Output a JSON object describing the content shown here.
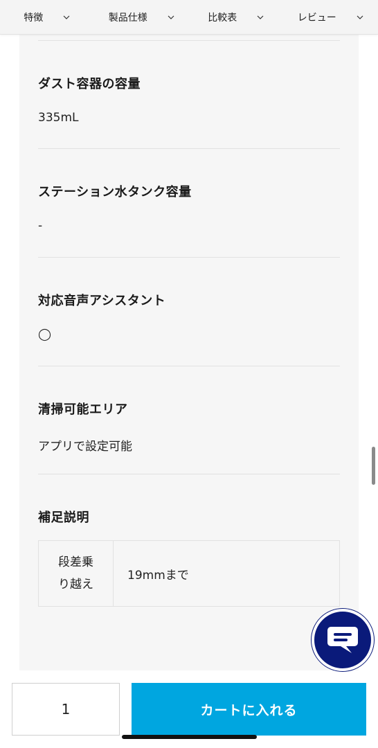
{
  "nav": {
    "tabs": [
      {
        "label": "特徴"
      },
      {
        "label": "製品仕様"
      },
      {
        "label": "比較表"
      },
      {
        "label": "レビュー"
      }
    ]
  },
  "specs": [
    {
      "label": "ダスト容器の容量",
      "value": "335mL"
    },
    {
      "label": "ステーション水タンク容量",
      "value": "-"
    },
    {
      "label": "対応音声アシスタント",
      "value": "◯"
    },
    {
      "label": "清掃可能エリア",
      "value": "アプリで設定可能"
    }
  ],
  "supplement": {
    "label": "補足説明",
    "table": {
      "header_line1": "段差乗",
      "header_line2": "り越え",
      "value": "19mmまで"
    }
  },
  "cart_bar": {
    "quantity": "1",
    "add_to_cart_label": "カートに入れる"
  },
  "colors": {
    "cart_button": "#00a6e0",
    "chat_button": "#0a1a7a",
    "panel_background": "#f6f6f6"
  },
  "icons": {
    "tab_chevron": "chevron-down-icon",
    "chat": "chat-icon"
  }
}
